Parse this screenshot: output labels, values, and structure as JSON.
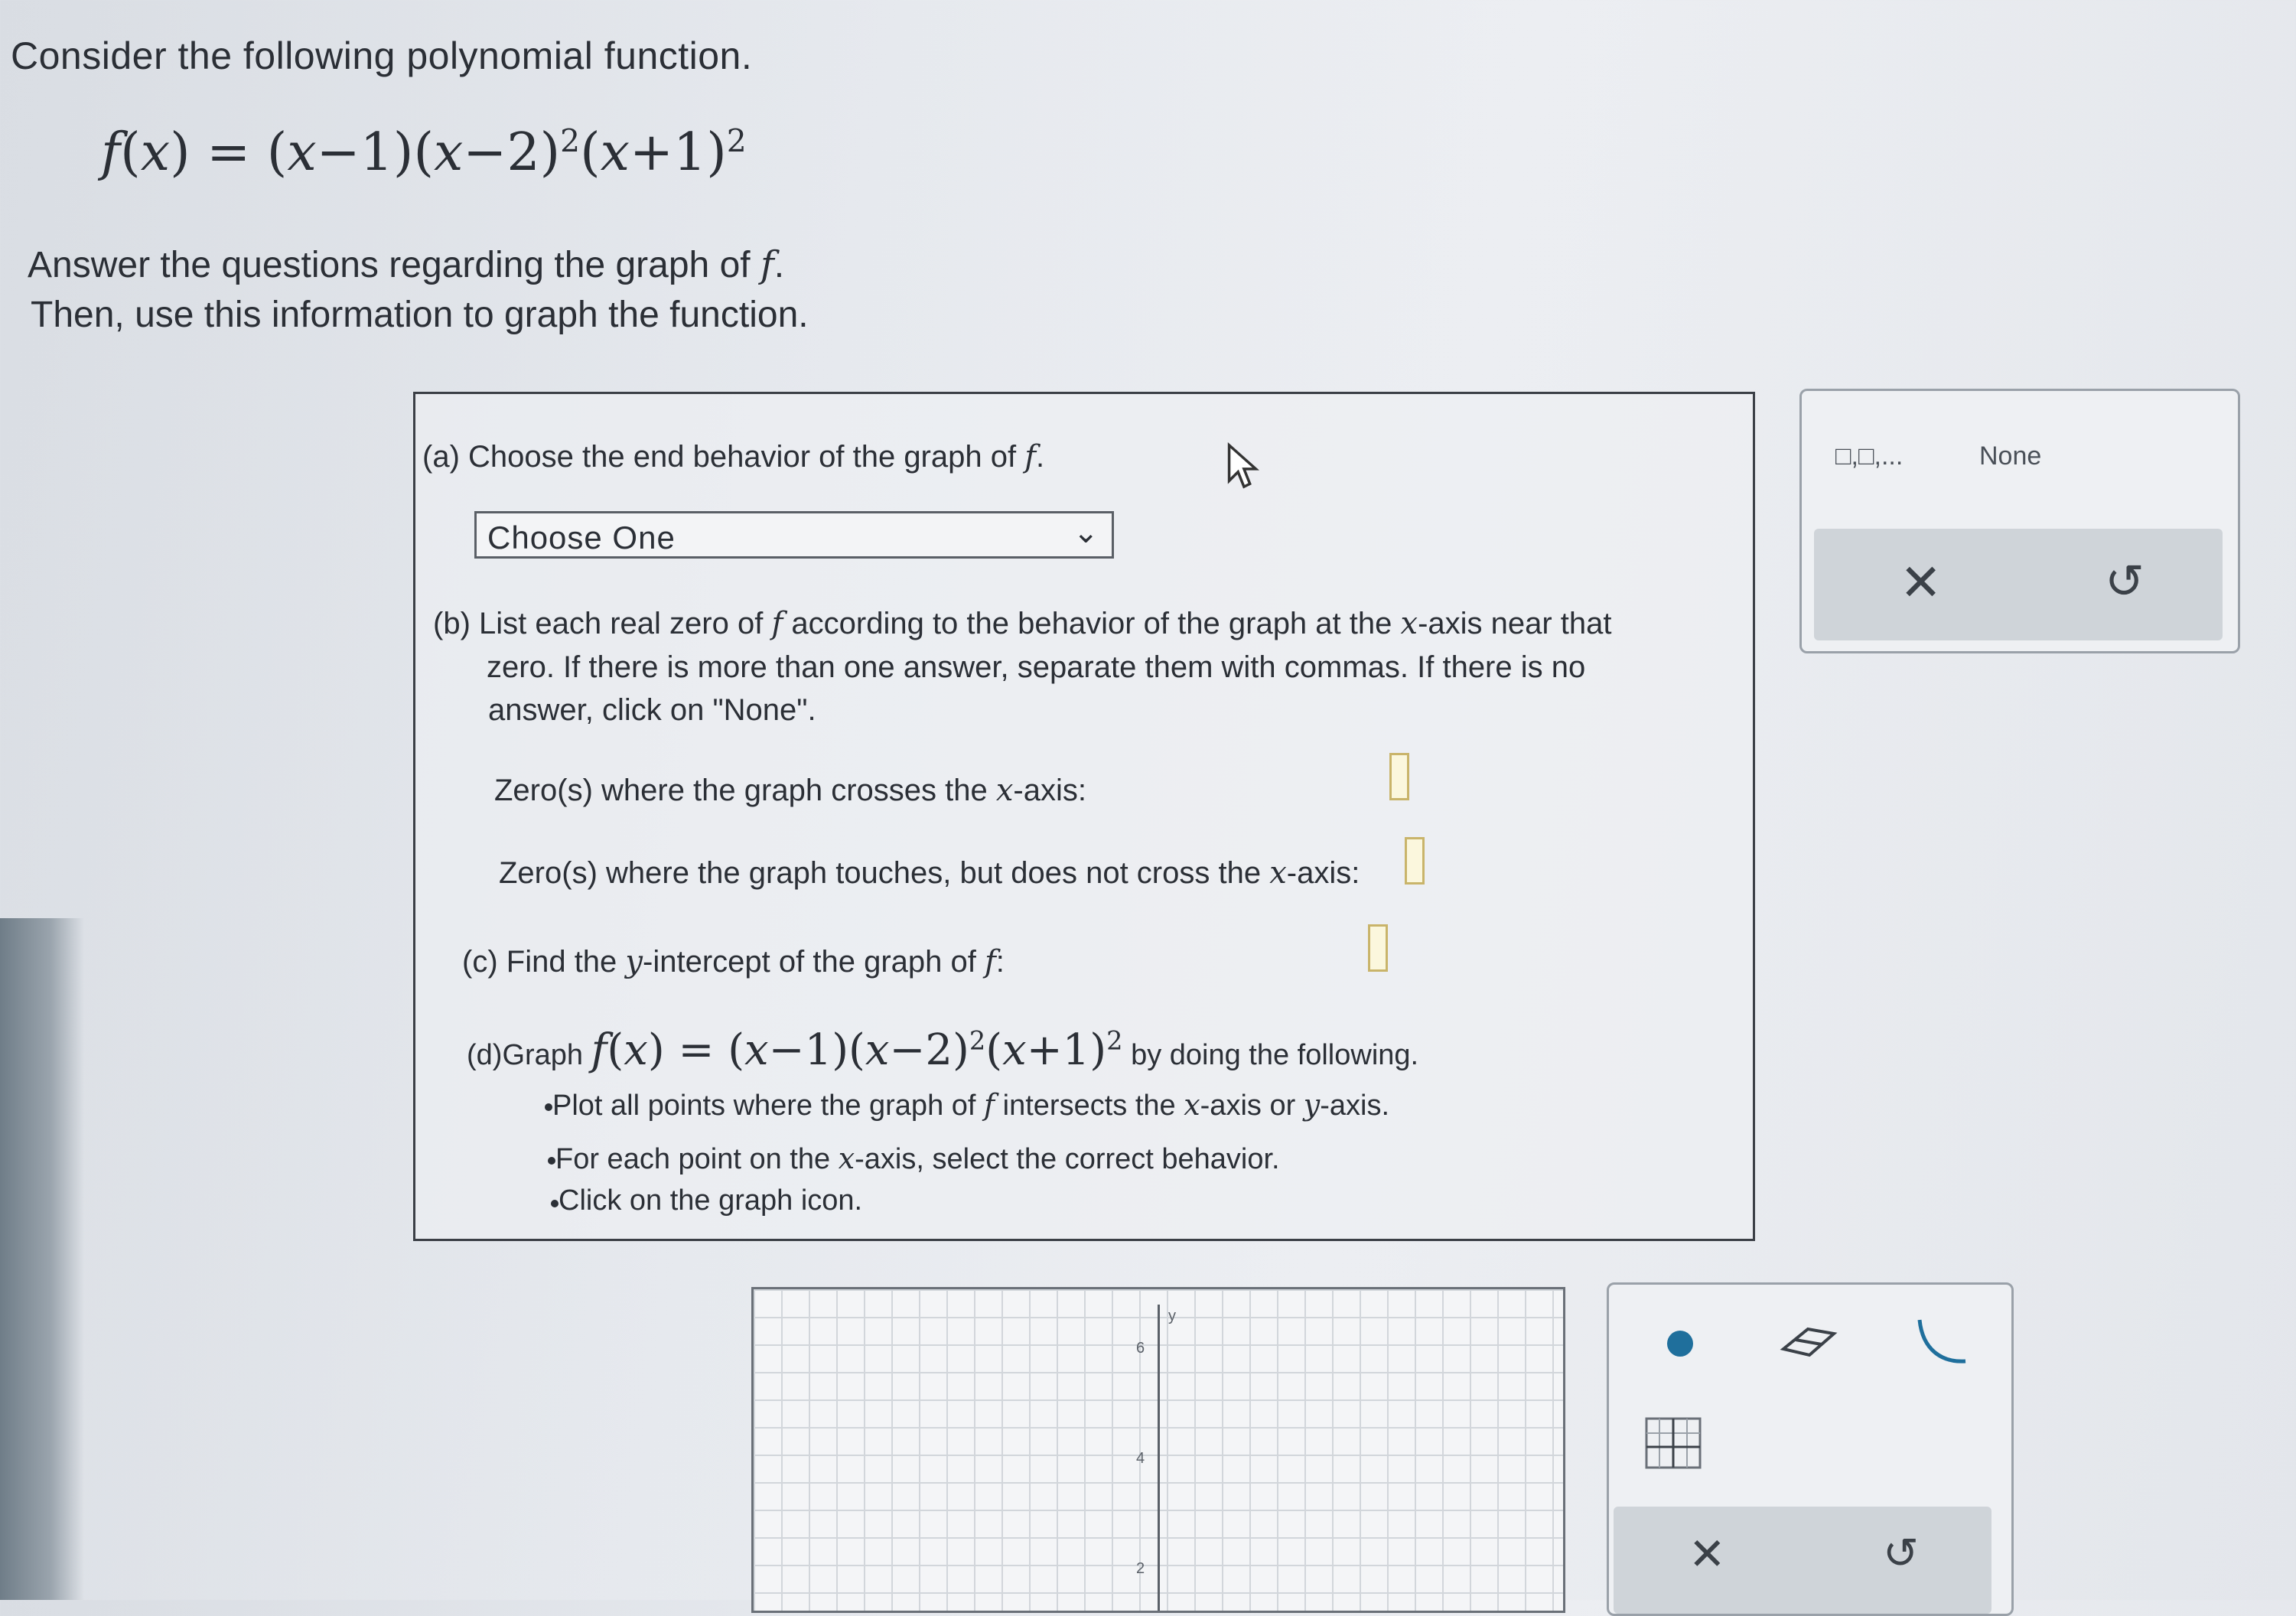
{
  "intro": "Consider the following polynomial function.",
  "answer_line1": "Answer the questions regarding the graph of",
  "answer_line2": "Then, use this information to graph the function.",
  "part_a": {
    "label": "(a)",
    "text": "Choose the end behavior of the graph of",
    "select_value": "Choose One"
  },
  "part_b": {
    "label": "(b)",
    "text1": "List each real zero of",
    "text1b": "according to the behavior of the graph at the",
    "text1c": "-axis near that",
    "text2": "zero. If there is more than one answer, separate them with commas. If there is no",
    "text3": "answer, click on \"None\".",
    "crosses_label": "Zero(s) where the graph crosses the",
    "crosses_tail": "-axis:",
    "touches_label": "Zero(s) where the graph touches, but does not cross the",
    "touches_tail": "-axis:"
  },
  "part_c": {
    "label": "(c)",
    "text": "Find the",
    "text_tail": "-intercept of the graph of"
  },
  "part_d": {
    "label": "(d)",
    "graph_word": "Graph",
    "tail": "by doing the following.",
    "bullets": [
      "Plot all points where the graph of",
      "intersects the",
      "-axis or",
      "-axis.",
      "For each point on the",
      "-axis, select the correct behavior.",
      "Click on the graph icon."
    ]
  },
  "tool_panel": {
    "list_icon_text": "□,□,...",
    "none_label": "None"
  },
  "graph": {
    "y_label": "y",
    "ticks": [
      "6",
      "4",
      "2"
    ]
  }
}
